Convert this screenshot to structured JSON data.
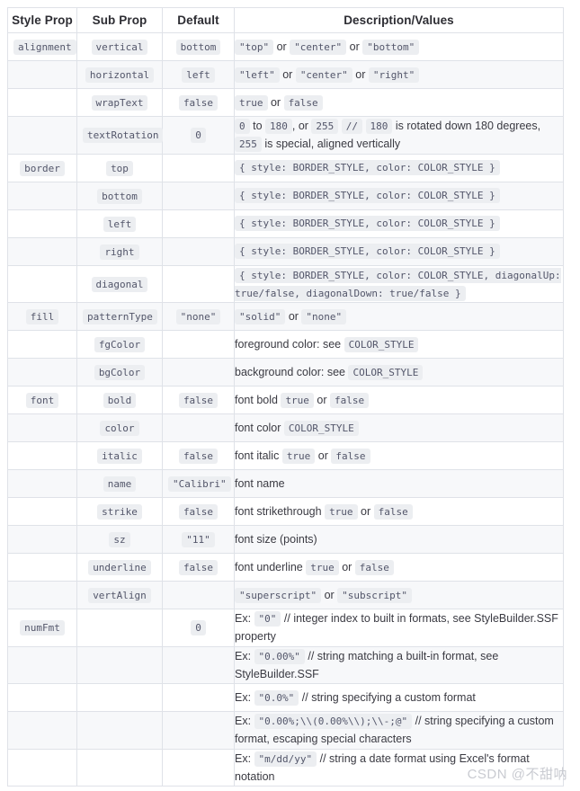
{
  "table": {
    "headers": [
      "Style Prop",
      "Sub Prop",
      "Default",
      "Description/Values"
    ],
    "watermark": "CSDN @不甜呐",
    "rows": [
      {
        "style_prop": "alignment",
        "sub_prop": "vertical",
        "default": "bottom",
        "desc": [
          {
            "t": "code",
            "v": "\"top\""
          },
          {
            "t": "text",
            "v": " or "
          },
          {
            "t": "code",
            "v": "\"center\""
          },
          {
            "t": "text",
            "v": " or "
          },
          {
            "t": "code",
            "v": "\"bottom\""
          }
        ]
      },
      {
        "style_prop": "",
        "sub_prop": "horizontal",
        "default": "left",
        "desc": [
          {
            "t": "code",
            "v": "\"left\""
          },
          {
            "t": "text",
            "v": " or "
          },
          {
            "t": "code",
            "v": "\"center\""
          },
          {
            "t": "text",
            "v": " or "
          },
          {
            "t": "code",
            "v": "\"right\""
          }
        ]
      },
      {
        "style_prop": "",
        "sub_prop": "wrapText",
        "default": "false",
        "desc": [
          {
            "t": "code",
            "v": "true"
          },
          {
            "t": "text",
            "v": " or "
          },
          {
            "t": "code",
            "v": "false"
          }
        ]
      },
      {
        "style_prop": "",
        "sub_prop": "textRotation",
        "default": "0",
        "desc": [
          {
            "t": "code",
            "v": "0"
          },
          {
            "t": "text",
            "v": " to "
          },
          {
            "t": "code",
            "v": "180"
          },
          {
            "t": "text",
            "v": ", or "
          },
          {
            "t": "code",
            "v": "255"
          },
          {
            "t": "text",
            "v": " "
          },
          {
            "t": "code",
            "v": "//"
          },
          {
            "t": "text",
            "v": " "
          },
          {
            "t": "code",
            "v": "180"
          },
          {
            "t": "text",
            "v": " is rotated down 180 degrees, "
          },
          {
            "t": "code",
            "v": "255"
          },
          {
            "t": "text",
            "v": " is special, aligned vertically"
          }
        ]
      },
      {
        "style_prop": "border",
        "sub_prop": "top",
        "default": "",
        "desc": [
          {
            "t": "code",
            "v": "{ style: BORDER_STYLE, color: COLOR_STYLE }"
          }
        ]
      },
      {
        "style_prop": "",
        "sub_prop": "bottom",
        "default": "",
        "desc": [
          {
            "t": "code",
            "v": "{ style: BORDER_STYLE, color: COLOR_STYLE }"
          }
        ]
      },
      {
        "style_prop": "",
        "sub_prop": "left",
        "default": "",
        "desc": [
          {
            "t": "code",
            "v": "{ style: BORDER_STYLE, color: COLOR_STYLE }"
          }
        ]
      },
      {
        "style_prop": "",
        "sub_prop": "right",
        "default": "",
        "desc": [
          {
            "t": "code",
            "v": "{ style: BORDER_STYLE, color: COLOR_STYLE }"
          }
        ]
      },
      {
        "style_prop": "",
        "sub_prop": "diagonal",
        "default": "",
        "desc": [
          {
            "t": "codewrap",
            "v": "{ style: BORDER_STYLE, color: COLOR_STYLE, diagonalUp: true/false, diagonalDown: true/false }"
          }
        ]
      },
      {
        "style_prop": "fill",
        "sub_prop": "patternType",
        "default": "\"none\"",
        "desc": [
          {
            "t": "code",
            "v": "\"solid\""
          },
          {
            "t": "text",
            "v": " or "
          },
          {
            "t": "code",
            "v": "\"none\""
          }
        ]
      },
      {
        "style_prop": "",
        "sub_prop": "fgColor",
        "default": "",
        "desc": [
          {
            "t": "text",
            "v": "foreground color: see "
          },
          {
            "t": "code",
            "v": "COLOR_STYLE"
          }
        ]
      },
      {
        "style_prop": "",
        "sub_prop": "bgColor",
        "default": "",
        "desc": [
          {
            "t": "text",
            "v": "background color: see "
          },
          {
            "t": "code",
            "v": "COLOR_STYLE"
          }
        ]
      },
      {
        "style_prop": "font",
        "sub_prop": "bold",
        "default": "false",
        "desc": [
          {
            "t": "text",
            "v": "font bold "
          },
          {
            "t": "code",
            "v": "true"
          },
          {
            "t": "text",
            "v": " or "
          },
          {
            "t": "code",
            "v": "false"
          }
        ]
      },
      {
        "style_prop": "",
        "sub_prop": "color",
        "default": "",
        "desc": [
          {
            "t": "text",
            "v": "font color "
          },
          {
            "t": "code",
            "v": "COLOR_STYLE"
          }
        ]
      },
      {
        "style_prop": "",
        "sub_prop": "italic",
        "default": "false",
        "desc": [
          {
            "t": "text",
            "v": "font italic "
          },
          {
            "t": "code",
            "v": "true"
          },
          {
            "t": "text",
            "v": " or "
          },
          {
            "t": "code",
            "v": "false"
          }
        ]
      },
      {
        "style_prop": "",
        "sub_prop": "name",
        "default": "\"Calibri\"",
        "desc": [
          {
            "t": "text",
            "v": "font name"
          }
        ]
      },
      {
        "style_prop": "",
        "sub_prop": "strike",
        "default": "false",
        "desc": [
          {
            "t": "text",
            "v": "font strikethrough "
          },
          {
            "t": "code",
            "v": "true"
          },
          {
            "t": "text",
            "v": " or "
          },
          {
            "t": "code",
            "v": "false"
          }
        ]
      },
      {
        "style_prop": "",
        "sub_prop": "sz",
        "default": "\"11\"",
        "desc": [
          {
            "t": "text",
            "v": "font size (points)"
          }
        ]
      },
      {
        "style_prop": "",
        "sub_prop": "underline",
        "default": "false",
        "desc": [
          {
            "t": "text",
            "v": "font underline "
          },
          {
            "t": "code",
            "v": "true"
          },
          {
            "t": "text",
            "v": " or "
          },
          {
            "t": "code",
            "v": "false"
          }
        ]
      },
      {
        "style_prop": "",
        "sub_prop": "vertAlign",
        "default": "",
        "desc": [
          {
            "t": "code",
            "v": "\"superscript\""
          },
          {
            "t": "text",
            "v": " or "
          },
          {
            "t": "code",
            "v": "\"subscript\""
          }
        ]
      },
      {
        "style_prop": "numFmt",
        "sub_prop": "",
        "default": "0",
        "desc": [
          {
            "t": "text",
            "v": "Ex: "
          },
          {
            "t": "code",
            "v": "\"0\""
          },
          {
            "t": "text",
            "v": " // integer index to built in formats, see StyleBuilder.SSF property"
          }
        ]
      },
      {
        "style_prop": "",
        "sub_prop": "",
        "default": "",
        "desc": [
          {
            "t": "text",
            "v": "Ex: "
          },
          {
            "t": "code",
            "v": "\"0.00%\""
          },
          {
            "t": "text",
            "v": " // string matching a built-in format, see StyleBuilder.SSF"
          }
        ]
      },
      {
        "style_prop": "",
        "sub_prop": "",
        "default": "",
        "desc": [
          {
            "t": "text",
            "v": "Ex: "
          },
          {
            "t": "code",
            "v": "\"0.0%\""
          },
          {
            "t": "text",
            "v": " // string specifying a custom format"
          }
        ]
      },
      {
        "style_prop": "",
        "sub_prop": "",
        "default": "",
        "desc": [
          {
            "t": "text",
            "v": "Ex: "
          },
          {
            "t": "code",
            "v": "\"0.00%;\\\\(0.00%\\\\);\\\\-;@\""
          },
          {
            "t": "text",
            "v": " // string specifying a custom format, escaping special characters"
          }
        ]
      },
      {
        "style_prop": "",
        "sub_prop": "",
        "default": "",
        "desc": [
          {
            "t": "text",
            "v": "Ex: "
          },
          {
            "t": "code",
            "v": "\"m/dd/yy\""
          },
          {
            "t": "text",
            "v": " // string a date format using Excel's format notation"
          }
        ]
      }
    ]
  }
}
